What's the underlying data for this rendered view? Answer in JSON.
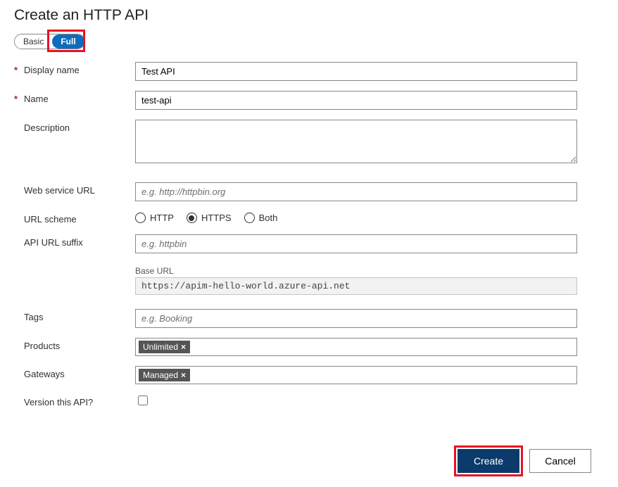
{
  "title": "Create an HTTP API",
  "toggle": {
    "basic": "Basic",
    "full": "Full"
  },
  "labels": {
    "displayName": "Display name",
    "name": "Name",
    "description": "Description",
    "webServiceUrl": "Web service URL",
    "urlScheme": "URL scheme",
    "apiUrlSuffix": "API URL suffix",
    "baseUrl": "Base URL",
    "tags": "Tags",
    "products": "Products",
    "gateways": "Gateways",
    "version": "Version this API?"
  },
  "values": {
    "displayName": "Test API",
    "name": "test-api",
    "description": "",
    "webServiceUrl": "",
    "apiUrlSuffix": "",
    "baseUrl": "https://apim-hello-world.azure-api.net",
    "tags": "",
    "productsChip": "Unlimited",
    "gatewaysChip": "Managed",
    "versionChecked": false
  },
  "placeholders": {
    "webServiceUrl": "e.g. http://httpbin.org",
    "apiUrlSuffix": "e.g. httpbin",
    "tags": "e.g. Booking"
  },
  "urlScheme": {
    "http": "HTTP",
    "https": "HTTPS",
    "both": "Both",
    "selected": "https"
  },
  "chipClose": "×",
  "buttons": {
    "create": "Create",
    "cancel": "Cancel"
  }
}
